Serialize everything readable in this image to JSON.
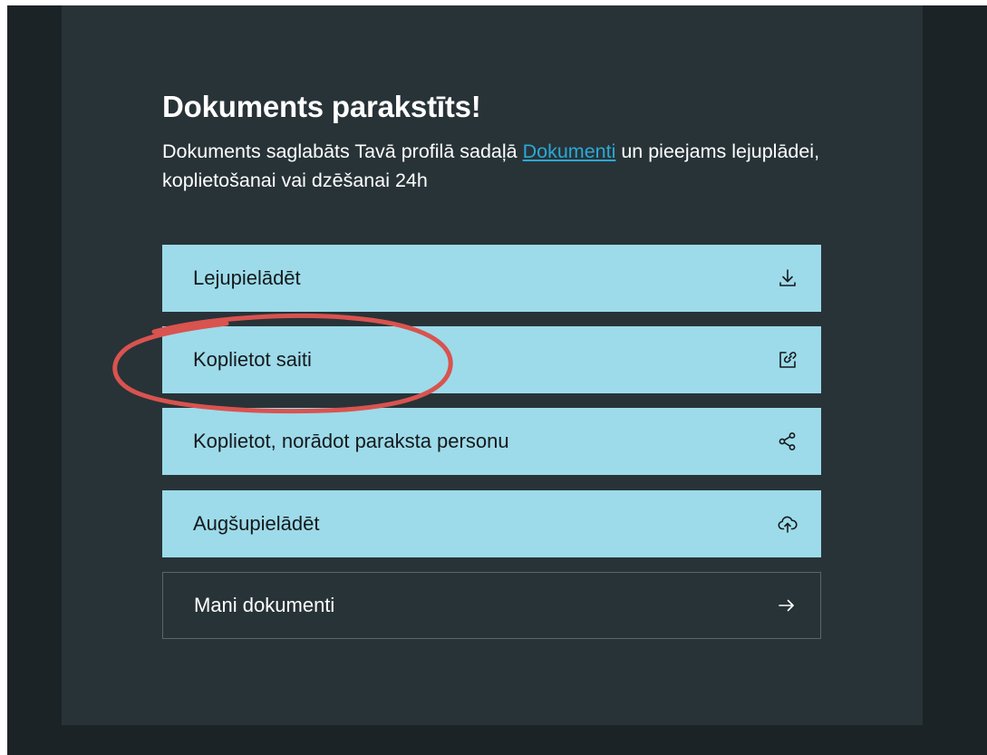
{
  "card": {
    "title": "Dokuments parakstīts!",
    "description_prefix": "Dokuments saglabāts Tavā profilā sadaļā ",
    "description_link": "Dokumenti",
    "description_suffix": " un pieejams lejuplādei, koplietošanai vai dzēšanai 24h"
  },
  "actions": {
    "download": {
      "label": "Lejupielādēt",
      "icon": "download-icon"
    },
    "share_link": {
      "label": "Koplietot saiti",
      "icon": "share-link-icon"
    },
    "share_signer": {
      "label": "Koplietot, norādot paraksta personu",
      "icon": "share-nodes-icon"
    },
    "upload": {
      "label": "Augšupielādēt",
      "icon": "cloud-upload-icon"
    },
    "my_documents": {
      "label": "Mani dokumenti",
      "icon": "arrow-right-icon"
    }
  },
  "colors": {
    "background": "#1c2327",
    "panel": "#283338",
    "button": "#9ddbea",
    "link": "#2aa9d6",
    "annotation": "#d9534f"
  }
}
